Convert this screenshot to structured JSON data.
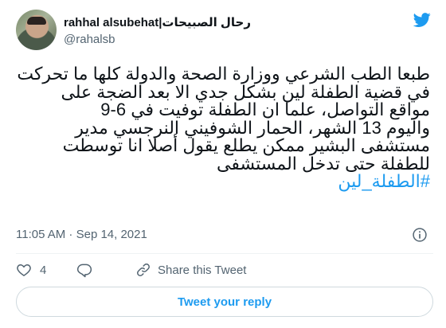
{
  "author": {
    "display_name": "rahhal alsubehat|رحال الصبيحات",
    "handle": "@rahalsb"
  },
  "tweet": {
    "lines": [
      "طبعا الطب الشرعي ووزارة الصحة والدولة كلها ما تحركت",
      "في قضية الطفلة لين بشكل جدي الا بعد الضجة على",
      "مواقع التواصل، علما ان الطفلة توفيت في 6-9",
      "واليوم 13 الشهر، الحمار الشوفيني النرجسي مدير",
      "مستشفى البشير ممكن يطلع يقول أصلا انا توسطت",
      "للطفلة حتى تدخل المستشفى"
    ],
    "hashtag": "#الطفلة_لين",
    "timestamp": "11:05 AM · Sep 14, 2021"
  },
  "actions": {
    "like_count": "4",
    "share_label": "Share this Tweet"
  },
  "reply_button_label": "Tweet your reply",
  "colors": {
    "accent": "#1d9bf0",
    "muted": "#536471",
    "border": "#cfd9de"
  }
}
